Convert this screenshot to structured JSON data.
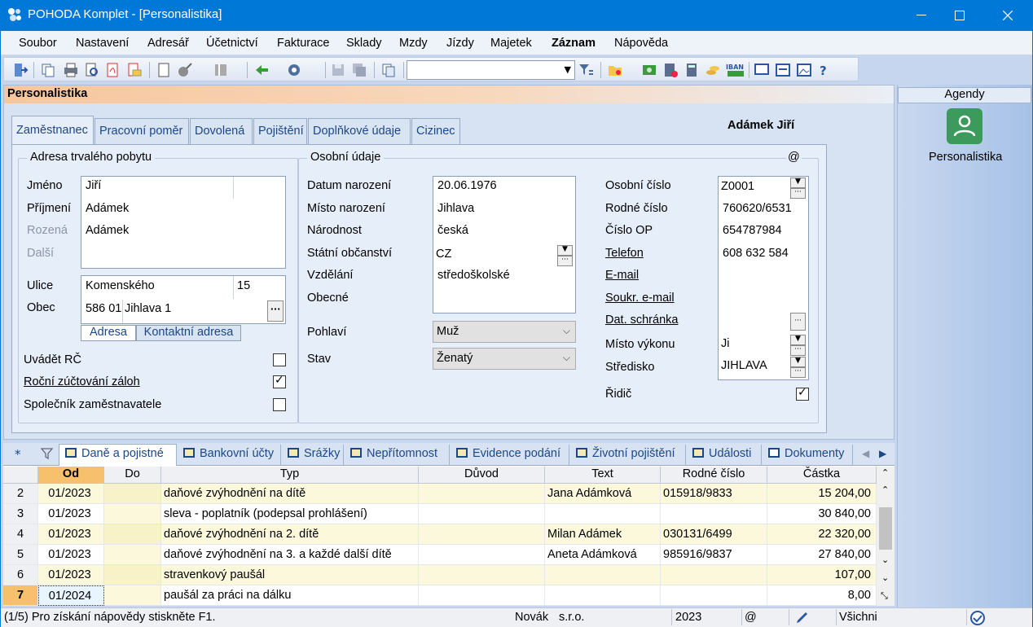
{
  "window": {
    "title": "POHODA Komplet - [Personalistika]"
  },
  "menu": [
    "Soubor",
    "Nastavení",
    "Adresář",
    "Účetnictví",
    "Fakturace",
    "Sklady",
    "Mzdy",
    "Jízdy",
    "Majetek",
    "Záznam",
    "Nápověda"
  ],
  "panel": {
    "title": "Personalistika",
    "person": "Adámek Jiří",
    "at": "@"
  },
  "tabs": [
    "Zaměstnanec",
    "Pracovní poměr",
    "Dovolená",
    "Pojištění",
    "Doplňkové údaje",
    "Cizinec"
  ],
  "address": {
    "group": "Adresa trvalého pobytu",
    "labels": {
      "jmeno": "Jméno",
      "prijmeni": "Příjmení",
      "rozena": "Rozená",
      "dalsi": "Další",
      "ulice": "Ulice",
      "obec": "Obec"
    },
    "jmeno": "Jiří",
    "prijmeni": "Adámek",
    "rozena": "Adámek",
    "ulice": "Komenského",
    "cislo": "15",
    "psc": "586 01",
    "mesto": "Jihlava 1",
    "tab_adresa": "Adresa",
    "tab_kontakt": "Kontaktní adresa"
  },
  "checks": {
    "uvadet": "Uvádět RČ",
    "rocni": "Roční zúčtování záloh",
    "spolecnik": "Společník zaměstnavatele",
    "ridic": "Řidič"
  },
  "personal": {
    "group": "Osobní údaje",
    "labels": {
      "datum": "Datum narození",
      "misto": "Místo narození",
      "narodnost": "Národnost",
      "obcanstvi": "Státní občanství",
      "vzdelani": "Vzdělání",
      "obecne": "Obecné",
      "pohlavi": "Pohlaví",
      "stav": "Stav"
    },
    "datum": "20.06.1976",
    "misto": "Jihlava",
    "narodnost": "česká",
    "obcanstvi": "CZ",
    "vzdelani": "středoškolské",
    "pohlavi": "Muž",
    "stav": "Ženatý"
  },
  "ids": {
    "labels": {
      "osobni": "Osobní číslo",
      "rodne": "Rodné číslo",
      "op": "Číslo OP",
      "telefon": "Telefon",
      "email": "E-mail",
      "soukr": "Soukr. e-mail",
      "dat": "Dat. schránka",
      "misto": "Místo výkonu",
      "stredisko": "Středisko"
    },
    "osobni": "Z0001",
    "rodne": "760620/6531",
    "op": "654787984",
    "telefon": "608 632 584",
    "misto": "Ji",
    "stredisko": "JIHLAVA"
  },
  "agenda": {
    "title": "Agendy",
    "item": "Personalistika"
  },
  "bottom_tabs": [
    "Daně a pojistné",
    "Bankovní účty",
    "Srážky",
    "Nepřítomnost",
    "Evidence podání",
    "Životní pojištění",
    "Události",
    "Dokumenty"
  ],
  "grid": {
    "columns": [
      "Od",
      "Do",
      "Typ",
      "Důvod",
      "Text",
      "Rodné číslo",
      "Částka"
    ],
    "rows": [
      {
        "n": "2",
        "od": "01/2023",
        "do": "",
        "typ": "daňové zvýhodnění na dítě",
        "duvod": "",
        "text": "Jana Adámková",
        "rc": "015918/9833",
        "castka": "15 204,00"
      },
      {
        "n": "3",
        "od": "01/2023",
        "do": "",
        "typ": "sleva - poplatník (podepsal prohlášení)",
        "duvod": "",
        "text": "",
        "rc": "",
        "castka": "30 840,00"
      },
      {
        "n": "4",
        "od": "01/2023",
        "do": "",
        "typ": "daňové zvýhodnění na 2. dítě",
        "duvod": "",
        "text": "Milan Adámek",
        "rc": "030131/6499",
        "castka": "22 320,00"
      },
      {
        "n": "5",
        "od": "01/2023",
        "do": "",
        "typ": "daňové zvýhodnění na 3. a každé další dítě",
        "duvod": "",
        "text": "Aneta Adámková",
        "rc": "985916/9837",
        "castka": "27 840,00"
      },
      {
        "n": "6",
        "od": "01/2023",
        "do": "",
        "typ": "stravenkový paušál",
        "duvod": "",
        "text": "",
        "rc": "",
        "castka": "107,00"
      },
      {
        "n": "7",
        "od": "01/2024",
        "do": "",
        "typ": "paušál za práci na dálku",
        "duvod": "",
        "text": "",
        "rc": "",
        "castka": "8,00"
      }
    ]
  },
  "status": {
    "hint": "(1/5) Pro získání nápovědy stiskněte F1.",
    "user": "Novák",
    "company": "s.r.o.",
    "year": "2023",
    "at": "@",
    "filter": "Všichni"
  }
}
